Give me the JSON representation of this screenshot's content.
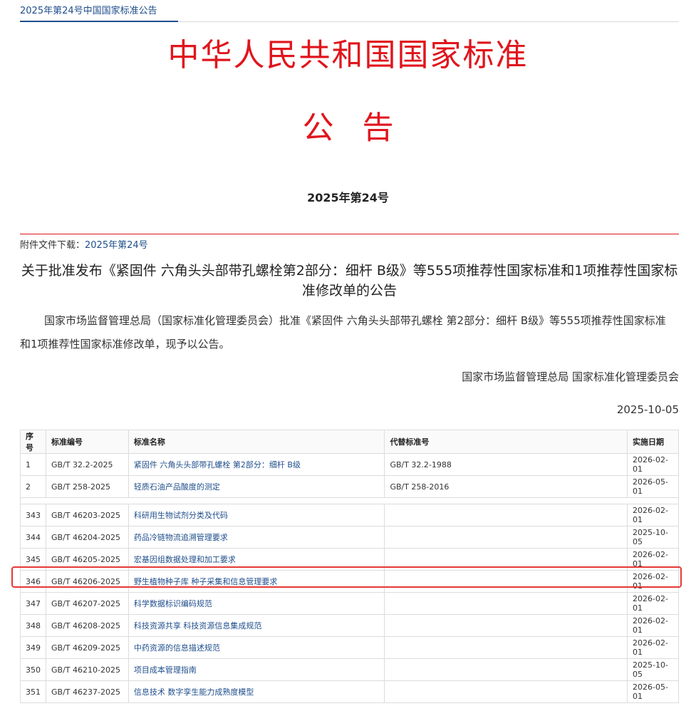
{
  "breadcrumb": "2025年第24号中国国家标准公告",
  "header": {
    "main_title": "中华人民共和国国家标准",
    "sub_title": "公告",
    "issue": "2025年第24号"
  },
  "attachment": {
    "label": "附件文件下载：",
    "link_text": "2025年第24号"
  },
  "notice": {
    "title": "关于批准发布《紧固件 六角头头部带孔螺栓第2部分：细杆 B级》等555项推荐性国家标准和1项推荐性国家标准修改单的公告",
    "body": "国家市场监督管理总局（国家标准化管理委员会）批准《紧固件 六角头头部带孔螺栓 第2部分：细杆 B级》等555项推荐性国家标准和1项推荐性国家标准修改单，现予以公告。",
    "signature": "国家市场监督管理总局 国家标准化管理委员会",
    "date": "2025-10-05"
  },
  "table": {
    "headers": [
      "序号",
      "标准编号",
      "标准名称",
      "代替标准号",
      "实施日期"
    ],
    "rows_top": [
      {
        "no": "1",
        "code": "GB/T 32.2-2025",
        "name": "紧固件 六角头头部带孔螺栓 第2部分：细杆 B级",
        "replaces": "GB/T 32.2-1988",
        "date": "2026-02-01"
      },
      {
        "no": "2",
        "code": "GB/T 258-2025",
        "name": "轻质石油产品酸度的测定",
        "replaces": "GB/T 258-2016",
        "date": "2026-05-01"
      }
    ],
    "rows_bottom": [
      {
        "no": "343",
        "code": "GB/T 46203-2025",
        "name": "科研用生物试剂分类及代码",
        "replaces": "",
        "date": "2026-02-01"
      },
      {
        "no": "344",
        "code": "GB/T 46204-2025",
        "name": "药品冷链物流追溯管理要求",
        "replaces": "",
        "date": "2025-10-05"
      },
      {
        "no": "345",
        "code": "GB/T 46205-2025",
        "name": "宏基因组数据处理和加工要求",
        "replaces": "",
        "date": "2026-02-01"
      },
      {
        "no": "346",
        "code": "GB/T 46206-2025",
        "name": "野生植物种子库 种子采集和信息管理要求",
        "replaces": "",
        "date": "2026-02-01"
      },
      {
        "no": "347",
        "code": "GB/T 46207-2025",
        "name": "科学数据标识编码规范",
        "replaces": "",
        "date": "2026-02-01"
      },
      {
        "no": "348",
        "code": "GB/T 46208-2025",
        "name": "科技资源共享 科技资源信息集成规范",
        "replaces": "",
        "date": "2026-02-01"
      },
      {
        "no": "349",
        "code": "GB/T 46209-2025",
        "name": "中药资源的信息描述规范",
        "replaces": "",
        "date": "2026-02-01"
      },
      {
        "no": "350",
        "code": "GB/T 46210-2025",
        "name": "项目成本管理指南",
        "replaces": "",
        "date": "2025-10-05"
      },
      {
        "no": "351",
        "code": "GB/T 46237-2025",
        "name": "信息技术 数字孪生能力成熟度模型",
        "replaces": "",
        "date": "2026-05-01"
      }
    ]
  },
  "colors": {
    "accent_red": "#e0151d",
    "link_blue": "#1f4e8c",
    "highlight": "#e53935"
  }
}
